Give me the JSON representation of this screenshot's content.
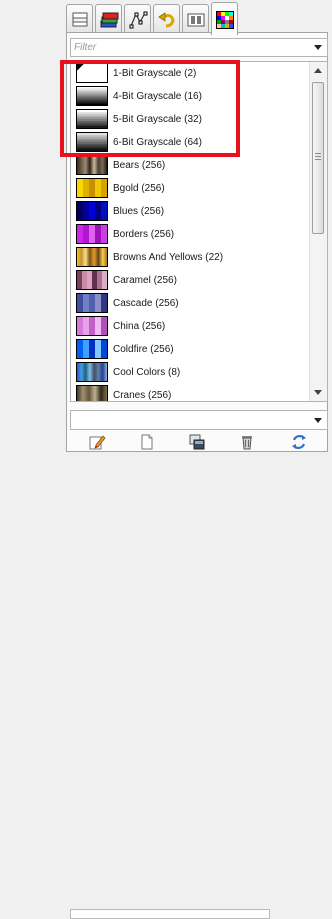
{
  "tabs": [
    {
      "icon": "layers-icon",
      "active": false
    },
    {
      "icon": "channels-icon",
      "active": false
    },
    {
      "icon": "paths-icon",
      "active": false
    },
    {
      "icon": "undo-history-icon",
      "active": false
    },
    {
      "icon": "device-status-icon",
      "active": false
    },
    {
      "icon": "palettes-icon",
      "active": true
    }
  ],
  "filter": {
    "placeholder": "Filter",
    "value": ""
  },
  "palettes": [
    {
      "label": "1-Bit Grayscale (2)",
      "colors": [
        "#ffffff",
        "#000000"
      ]
    },
    {
      "label": "4-Bit Grayscale (16)",
      "colors": [
        "#ffffff",
        "#eeeeee",
        "#dddddd",
        "#cccccc",
        "#bbbbbb",
        "#aaaaaa",
        "#999999",
        "#888888",
        "#777777",
        "#666666",
        "#555555",
        "#444444",
        "#333333",
        "#222222",
        "#111111",
        "#000000"
      ]
    },
    {
      "label": "5-Bit Grayscale (32)",
      "colors": [
        "#ffffff",
        "#e6e6e6",
        "#cccccc",
        "#b3b3b3",
        "#999999",
        "#808080",
        "#666666",
        "#4d4d4d",
        "#333333",
        "#1a1a1a"
      ]
    },
    {
      "label": "6-Bit Grayscale (64)",
      "colors": [
        "#e0e0e0",
        "#c8c8c8",
        "#b0b0b0",
        "#989898",
        "#808080",
        "#686868",
        "#505050",
        "#383838",
        "#202020",
        "#101010"
      ]
    },
    {
      "label": "Bears (256)",
      "colors": [
        "#3b2a1c",
        "#6e5a44",
        "#9a8a72",
        "#2e2218",
        "#c9b89a",
        "#4e3e2c",
        "#7a6a56",
        "#1f1810"
      ]
    },
    {
      "label": "Bgold (256)",
      "colors": [
        "#f8d800",
        "#e0b000",
        "#c89000",
        "#f0c800",
        "#d8a000"
      ]
    },
    {
      "label": "Blues (256)",
      "colors": [
        "#000060",
        "#0000a0",
        "#0000d8",
        "#000080",
        "#0010c0"
      ]
    },
    {
      "label": "Borders (256)",
      "colors": [
        "#d028e8",
        "#b018d0",
        "#e060f0",
        "#a010b8",
        "#c840e0"
      ]
    },
    {
      "label": "Browns And Yellows (22)",
      "colors": [
        "#f0c800",
        "#c89040",
        "#f8e080",
        "#805020",
        "#e0a020",
        "#604020",
        "#f8d040",
        "#a87030"
      ]
    },
    {
      "label": "Caramel (256)",
      "colors": [
        "#7a4060",
        "#c88ca8",
        "#e0a0c0",
        "#603050",
        "#b07090",
        "#d8b0c8"
      ]
    },
    {
      "label": "Cascade (256)",
      "colors": [
        "#4050a0",
        "#7080c0",
        "#5060b0",
        "#8890c8",
        "#303880"
      ]
    },
    {
      "label": "China (256)",
      "colors": [
        "#d878d8",
        "#e8a0e8",
        "#c060c8",
        "#f0b8f0",
        "#b050b8"
      ]
    },
    {
      "label": "Coldfire (256)",
      "colors": [
        "#0060f0",
        "#40a0ff",
        "#0030c0",
        "#80c8ff",
        "#0048d8"
      ]
    },
    {
      "label": "Cool Colors (8)",
      "colors": [
        "#3050c0",
        "#40a0e0",
        "#206080",
        "#80c0e0",
        "#405070",
        "#6080a0",
        "#2040a0",
        "#90b0d0"
      ]
    },
    {
      "label": "Cranes (256)",
      "colors": [
        "#403828",
        "#a09070",
        "#605840",
        "#c0b090",
        "#302818",
        "#807050"
      ]
    }
  ],
  "bottom_combo": {
    "value": ""
  },
  "toolbar": [
    {
      "icon": "edit-palette-icon"
    },
    {
      "icon": "new-palette-icon"
    },
    {
      "icon": "duplicate-palette-icon"
    },
    {
      "icon": "delete-palette-icon"
    },
    {
      "icon": "refresh-palettes-icon"
    }
  ],
  "annotation": {
    "color": "#e8121e"
  }
}
